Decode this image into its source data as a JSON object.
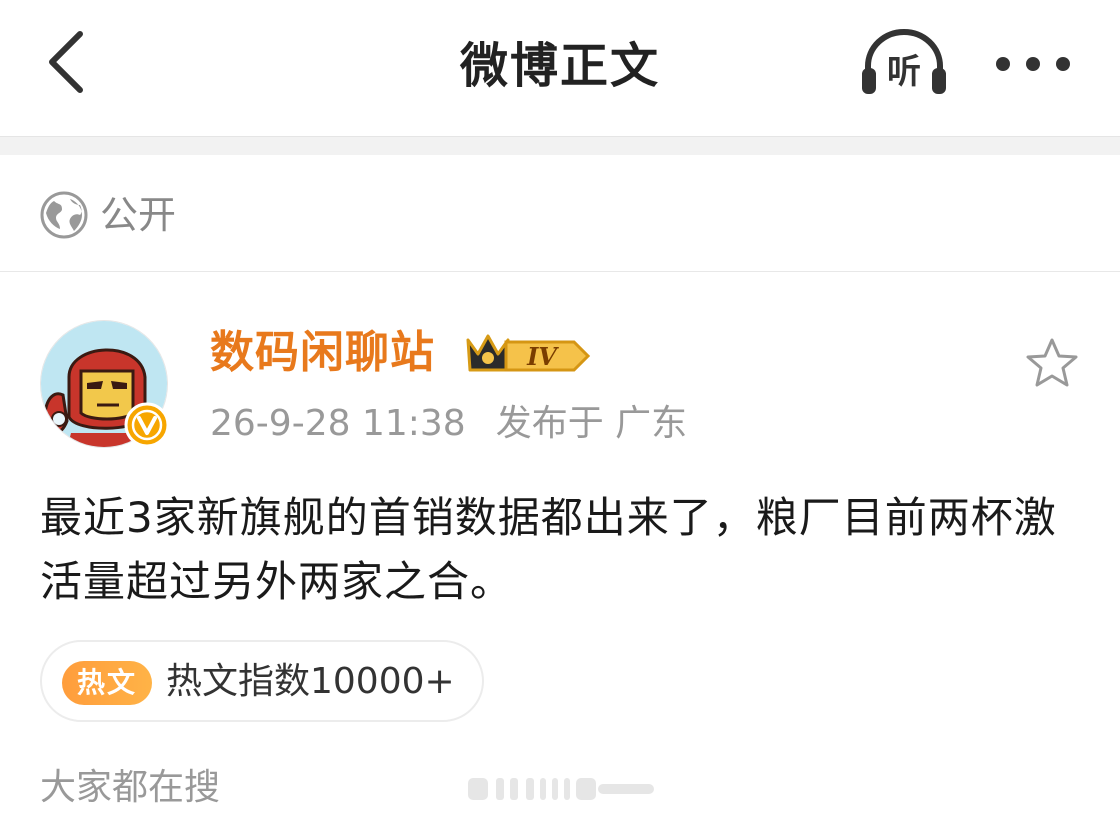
{
  "header": {
    "title": "微博正文",
    "listen_label": "听",
    "back_icon": "chevron-left-icon",
    "more_icon": "more-dots-icon"
  },
  "visibility": {
    "label": "公开",
    "icon": "globe-icon"
  },
  "post": {
    "author": {
      "name": "数码闲聊站",
      "vip_level": "IV",
      "verified_icon": "verified-v-icon"
    },
    "timestamp": "26-9-28 11:38",
    "location": "发布于 广东",
    "text": "最近3家新旗舰的首销数据都出来了，粮厂目前两杯激活量超过另外两家之合。",
    "hot_badge": "热文",
    "hot_index_text": "热文指数10000+"
  },
  "search": {
    "title": "大家都在搜"
  },
  "colors": {
    "username": "#e8791c",
    "hot_badge": "#ffa43e",
    "muted_text": "#999999"
  }
}
